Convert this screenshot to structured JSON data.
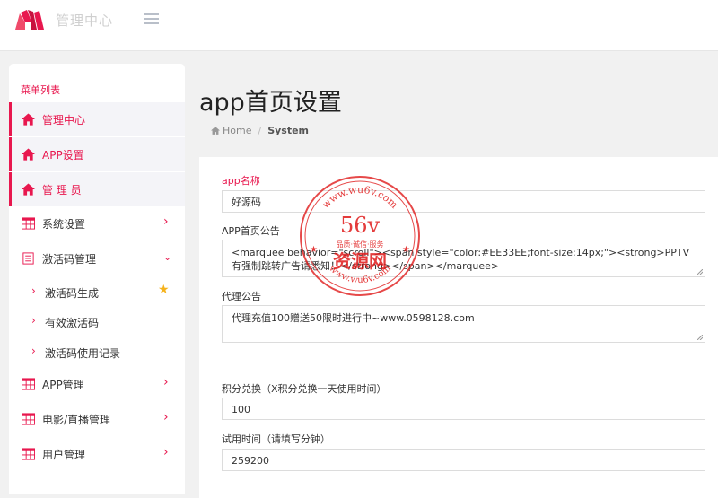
{
  "header": {
    "brand_title": "管理中心"
  },
  "sidebar": {
    "title": "菜单列表",
    "items": [
      {
        "label": "管理中心",
        "icon": "home-icon",
        "active": true
      },
      {
        "label": "APP设置",
        "icon": "home-icon",
        "active": true
      },
      {
        "label": "管 理 员",
        "icon": "home-icon",
        "active": true
      },
      {
        "label": "系统设置",
        "icon": "table-icon"
      },
      {
        "label": "激活码管理",
        "icon": "document-icon"
      },
      {
        "label": "APP管理",
        "icon": "table-icon"
      },
      {
        "label": "电影/直播管理",
        "icon": "table-icon"
      },
      {
        "label": "用户管理",
        "icon": "table-icon"
      }
    ],
    "subitems": [
      {
        "label": "激活码生成"
      },
      {
        "label": "有效激活码"
      },
      {
        "label": "激活码使用记录"
      }
    ],
    "colors": {
      "accent": "#e8174e",
      "star": "#f5b21b"
    }
  },
  "page": {
    "title": "app首页设置",
    "breadcrumb": {
      "home": "Home",
      "current": "System"
    }
  },
  "form": {
    "app_name": {
      "label": "app名称",
      "value": "好源码"
    },
    "home_notice": {
      "label": "APP首页公告",
      "value": "<marquee behavior=\"scroll\"><span style=\"color:#EE33EE;font-size:14px;\"><strong>PPTV有强制跳转广告请悉知！</strong></span></marquee>"
    },
    "agent_notice": {
      "label": "代理公告",
      "value": "代理充值100赠送50限时进行中~www.0598128.com"
    },
    "points_exchange": {
      "label": "积分兑换（X积分兑换一天使用时间）",
      "value": "100"
    },
    "trial_time": {
      "label": "试用时间（请填写分钟）",
      "value": "259200"
    }
  },
  "watermark": {
    "top_text": "www.wu6v.com",
    "number": "56v",
    "slogan": "品质·诚信·服务",
    "name": "资源网",
    "bottom_text": "www.wu6v.com"
  }
}
